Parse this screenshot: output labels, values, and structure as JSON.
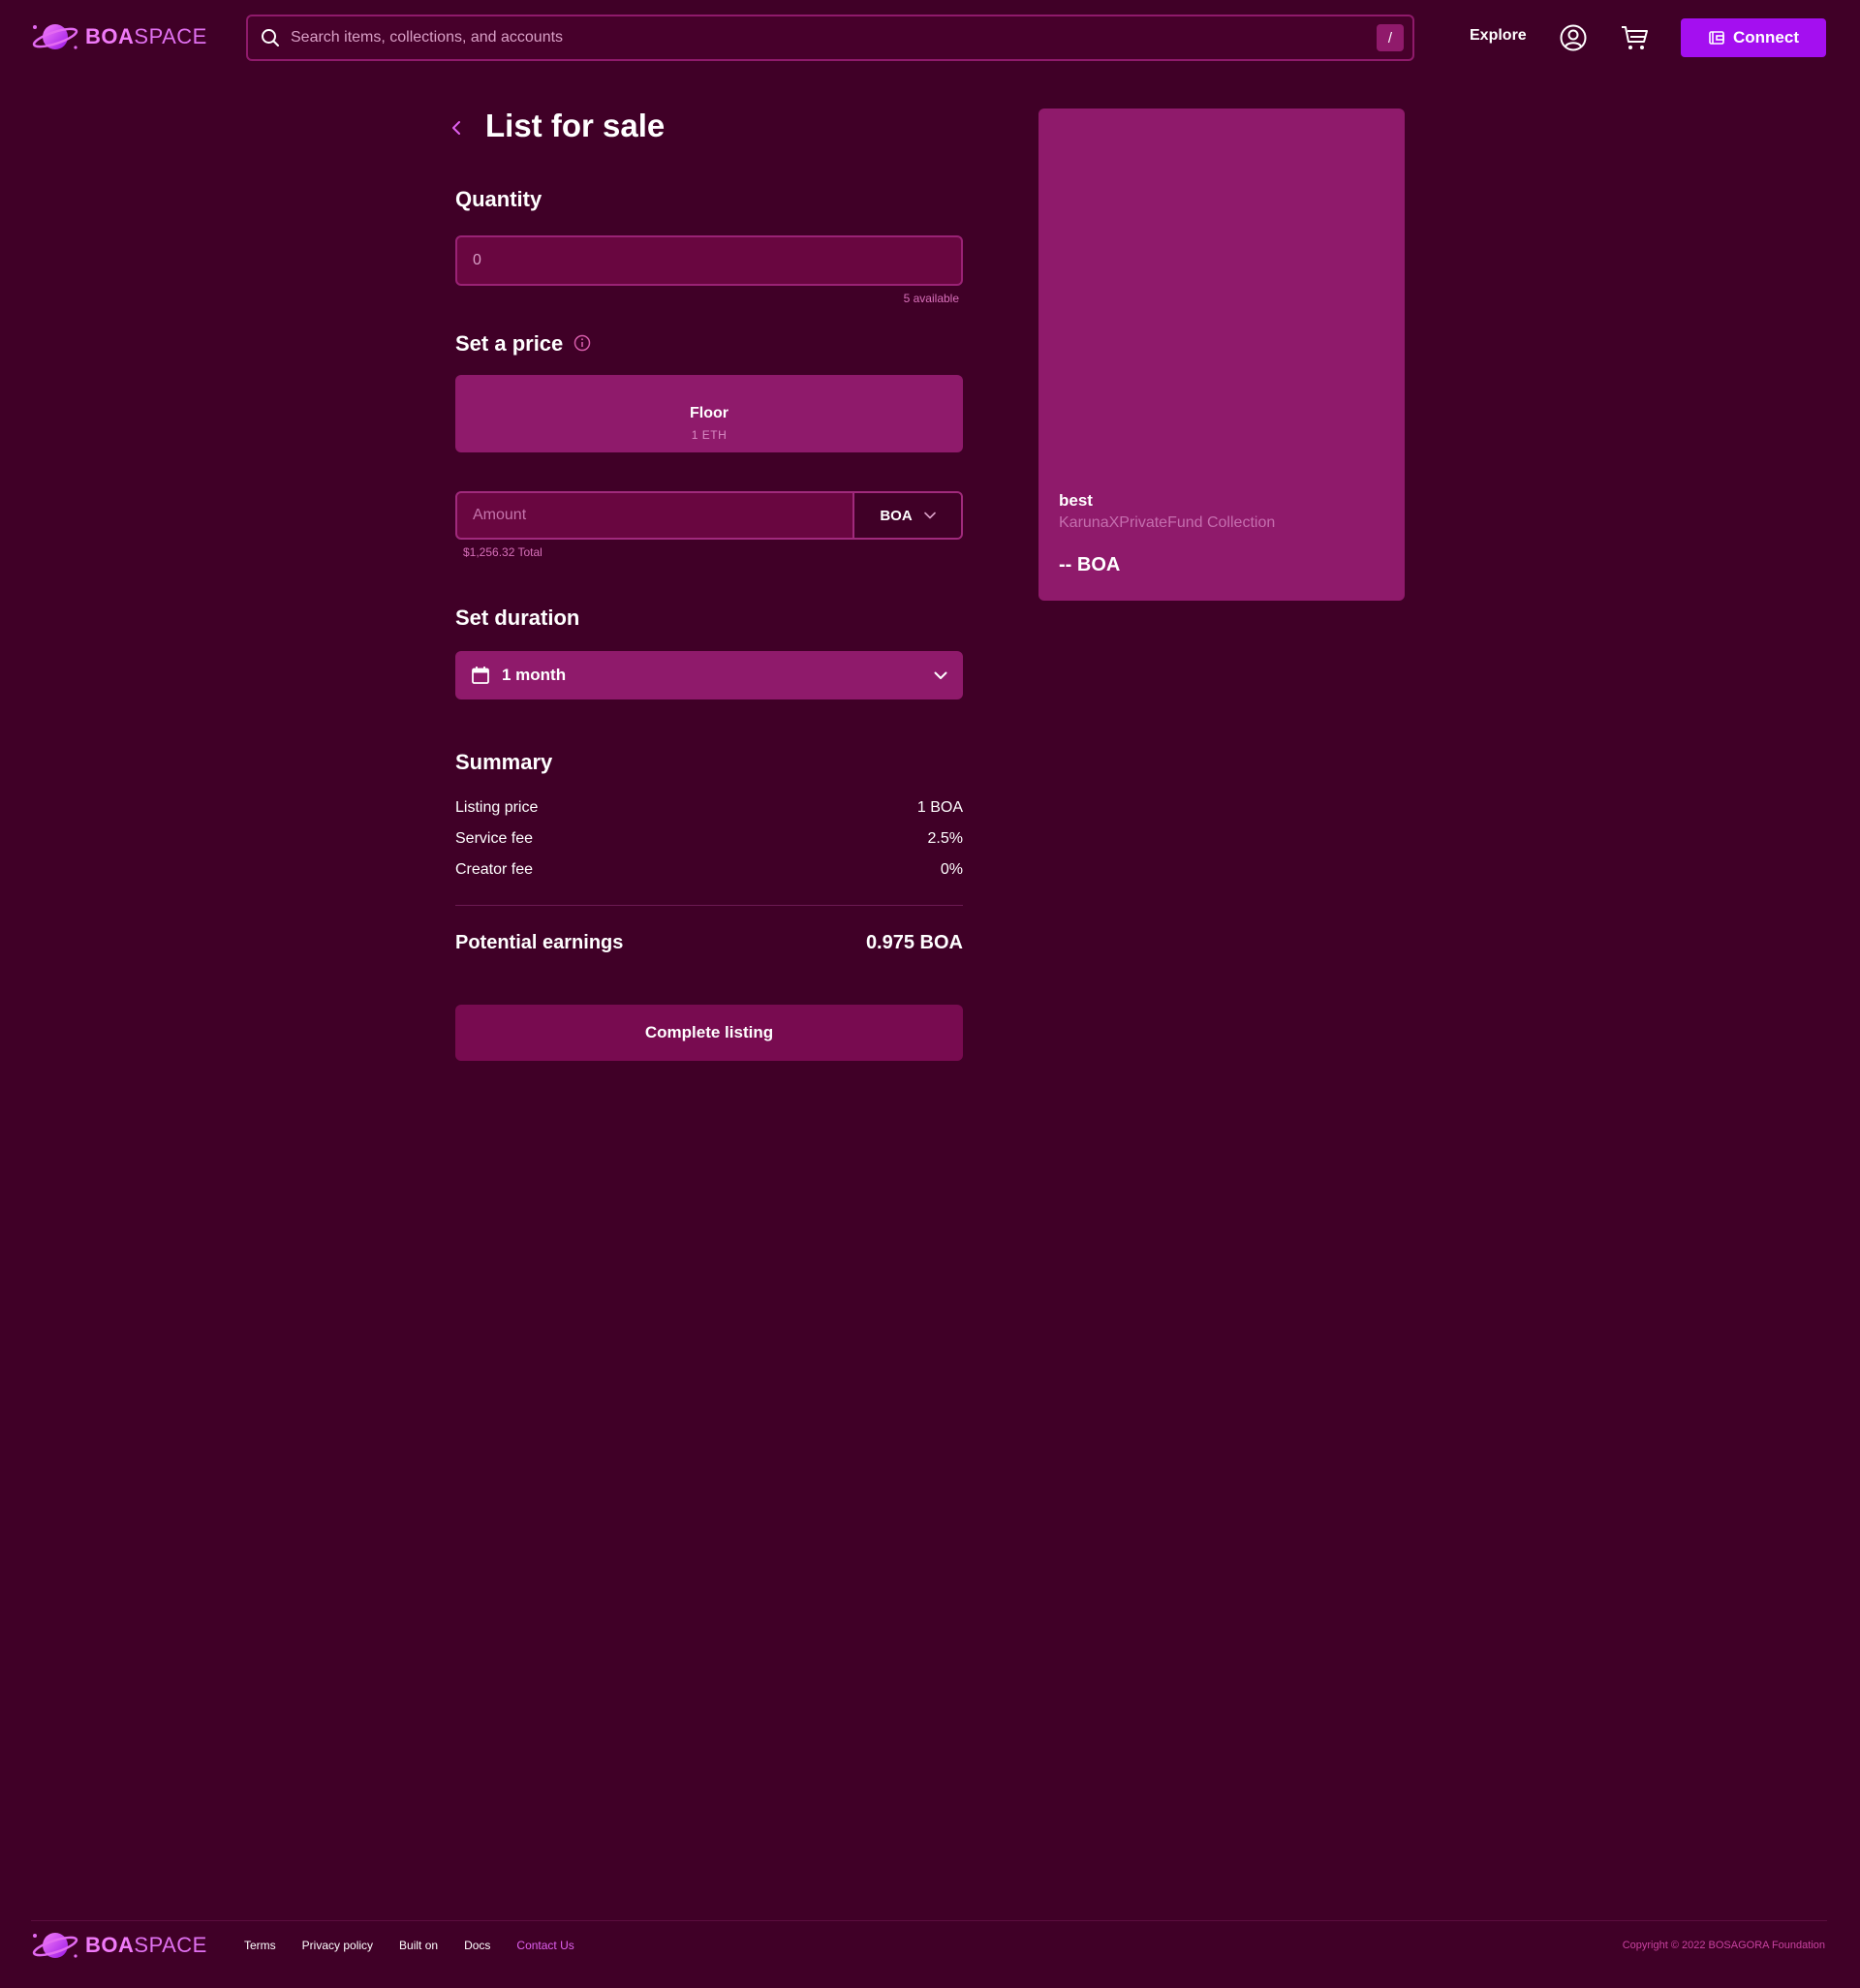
{
  "brand": {
    "name_bold": "BOA",
    "name_light": "SPACE"
  },
  "header": {
    "search_placeholder": "Search items, collections, and accounts",
    "search_shortcut": "/",
    "explore_label": "Explore",
    "connect_label": "Connect"
  },
  "page": {
    "title": "List for sale"
  },
  "quantity": {
    "title": "Quantity",
    "placeholder": "0",
    "available": "5 available"
  },
  "price": {
    "title": "Set a price",
    "floor_label": "Floor",
    "floor_value": "1 ETH",
    "amount_placeholder": "Amount",
    "currency": "BOA",
    "total": "$1,256.32 Total"
  },
  "duration": {
    "title": "Set duration",
    "value": "1 month"
  },
  "summary": {
    "title": "Summary",
    "rows": [
      {
        "label": "Listing price",
        "value": "1 BOA"
      },
      {
        "label": "Service fee",
        "value": "2.5%"
      },
      {
        "label": "Creator fee",
        "value": "0%"
      }
    ],
    "earnings_label": "Potential earnings",
    "earnings_value": "0.975 BOA"
  },
  "complete_label": "Complete listing",
  "preview": {
    "name": "best",
    "collection": "KarunaXPrivateFund Collection",
    "price": "-- BOA"
  },
  "footer": {
    "links": [
      "Terms",
      "Privacy policy",
      "Built on",
      "Docs",
      "Contact Us"
    ],
    "copyright": "Copyright © 2022 BOSAGORA Foundation"
  },
  "colors": {
    "background": "#400027",
    "accent": "#a40ff0",
    "card": "#8f1a6b",
    "brand_pink": "#f07af8"
  }
}
